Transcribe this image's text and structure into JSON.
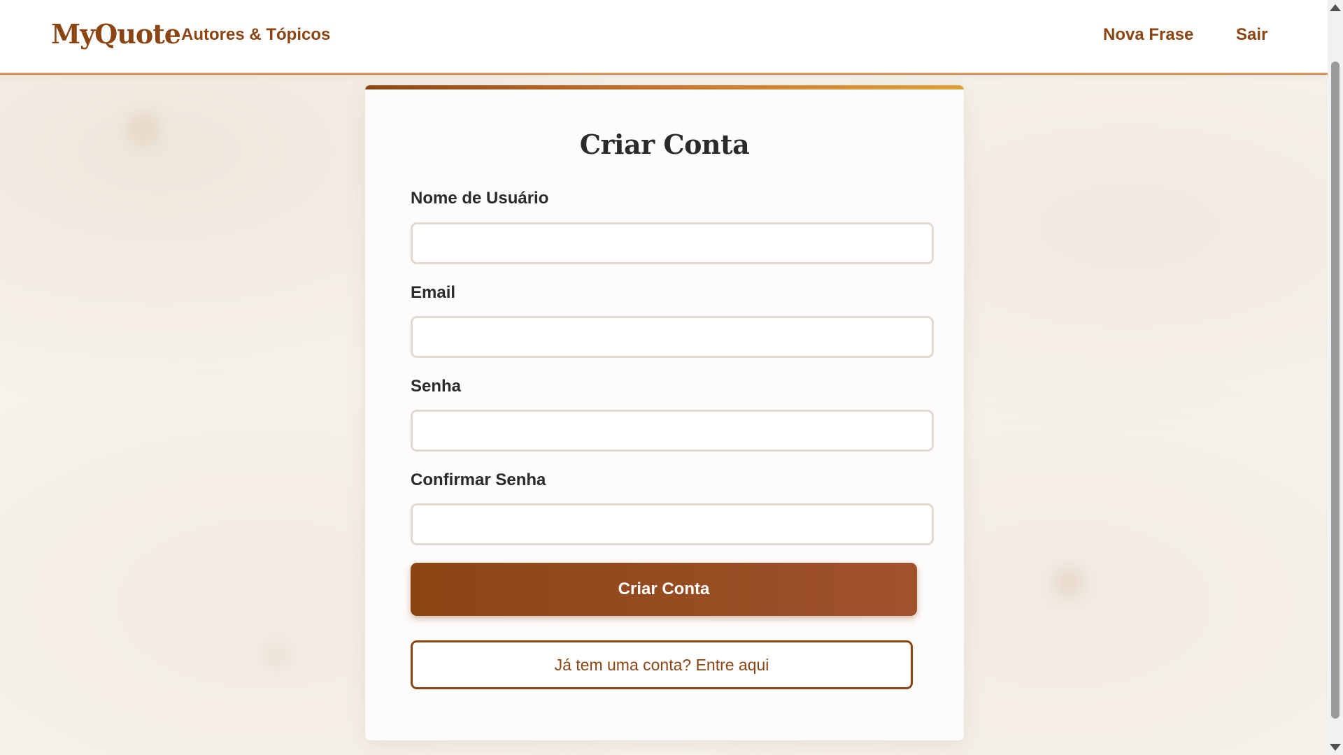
{
  "header": {
    "brand": "MyQuote",
    "nav_left": [
      {
        "label": "Autores & Tópicos"
      }
    ],
    "nav_right": [
      {
        "label": "Nova Frase"
      },
      {
        "label": "Sair"
      }
    ]
  },
  "form": {
    "title": "Criar Conta",
    "fields": [
      {
        "label": "Nome de Usuário",
        "value": "",
        "placeholder": ""
      },
      {
        "label": "Email",
        "value": "",
        "placeholder": ""
      },
      {
        "label": "Senha",
        "value": "",
        "placeholder": ""
      },
      {
        "label": "Confirmar Senha",
        "value": "",
        "placeholder": ""
      }
    ],
    "submit_label": "Criar Conta",
    "login_link_label": "Já tem uma conta? Entre aqui"
  },
  "colors": {
    "brand": "#8b4513",
    "accent_border": "#d9935a",
    "background": "#f6f2ec",
    "text": "#2c2a28"
  }
}
